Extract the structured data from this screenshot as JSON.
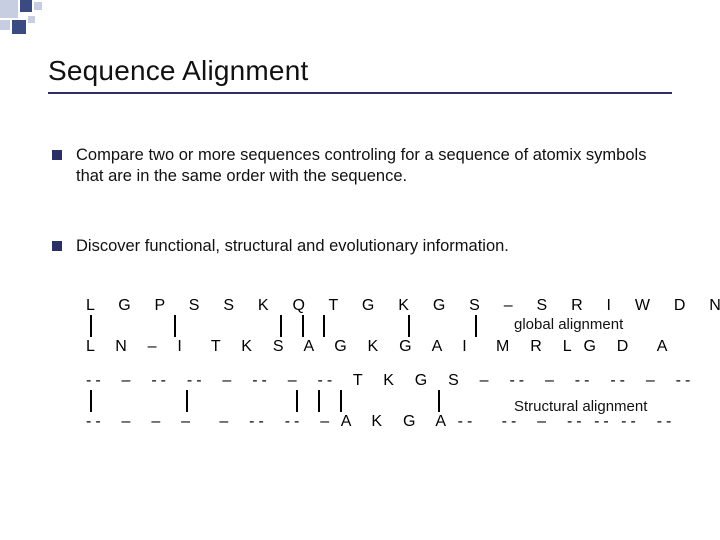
{
  "title": "Sequence Alignment",
  "bullets": [
    "Compare two or more sequences controling for a sequence of atomix symbols that are in the same order with the sequence.",
    "Discover functional, structural and evolutionary information."
  ],
  "alignment": {
    "global": {
      "seq1": "L  G  P  S  S  K  Q  T  G  K  G  S  –  S  R  I  W  D  N",
      "seq2": "L  N  –  I   T  K  S  A  G  K  G  A  I   M  R  L G  D   A",
      "label": "global alignment"
    },
    "structural": {
      "seq1": "--  –  --  --  –  --  –  --  T  K  G  S  –  --  –  --  --  –  --",
      "seq2": "--  –  –  –   –  --  --  – A  K  G  A --   --  –  -- -- --  --",
      "label": "Structural alignment"
    }
  }
}
